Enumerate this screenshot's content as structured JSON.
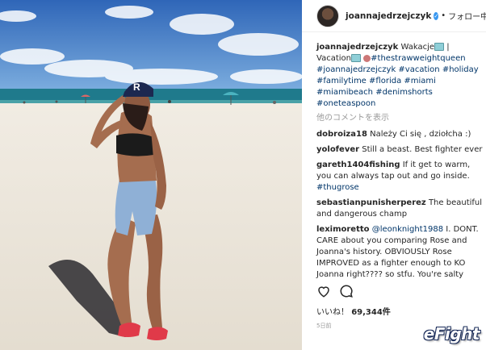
{
  "header": {
    "username": "joannajedrzejczyk",
    "verified_mark": "✓",
    "dot": "•",
    "follow_label": "フォロー中"
  },
  "caption": {
    "username": "joannajedrzejczyk",
    "text_parts": [
      "Wakacje",
      " | Vacation"
    ],
    "hashtags": [
      "#thestrawweightqueen",
      "#joannajedrzejczyk",
      "#vacation",
      "#holiday",
      "#familytime",
      "#florida",
      "#miami",
      "#miamibeach",
      "#denimshorts",
      "#oneteaspoon"
    ]
  },
  "more_comments": "他のコメントを表示",
  "comments": [
    {
      "user": "dobroiza18",
      "text": "Należy Ci się , dziołcha :)"
    },
    {
      "user": "yolofever",
      "text": "Still a beast. Best fighter ever"
    },
    {
      "user": "gareth1404fishing",
      "text": "If it get to warm, you can always tap out and go inside.",
      "tag": "#thugrose"
    },
    {
      "user": "sebastianpunisherperez",
      "text": "The beautiful and dangerous champ"
    },
    {
      "user": "leximoretto",
      "mention": "@leonknight1988",
      "text": " I. DONT. CARE about you comparing Rose and Joanna's history. OBVIOUSLY Rose IMPROVED as a fighter enough to KO Joanna right???? so stfu. You're salty"
    }
  ],
  "actions": {
    "like_icon": "heart-icon",
    "comment_icon": "speech-bubble-icon"
  },
  "likes": {
    "label": "いいね！",
    "count": "69,344件"
  },
  "age": "5日前",
  "watermark": "eFight",
  "colors": {
    "hashtag": "#003569",
    "verified": "#3897f0",
    "sky": "#3a72c4",
    "sand": "#ece6dc",
    "sea": "#1f7a8c"
  }
}
